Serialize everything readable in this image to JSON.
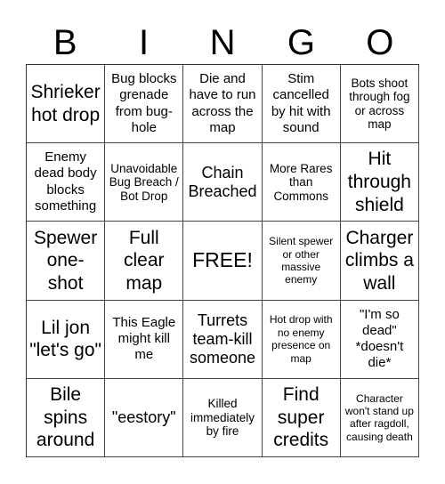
{
  "header": {
    "letters": [
      "B",
      "I",
      "N",
      "G",
      "O"
    ]
  },
  "grid": {
    "rows": [
      [
        {
          "text": "Shrieker hot drop"
        },
        {
          "text": "Bug blocks grenade from bug-hole"
        },
        {
          "text": "Die and have to run across the map"
        },
        {
          "text": "Stim cancelled by hit with sound"
        },
        {
          "text": "Bots shoot through fog or across map"
        }
      ],
      [
        {
          "text": "Enemy dead body blocks something"
        },
        {
          "text": "Unavoidable Bug Breach / Bot Drop"
        },
        {
          "text": "Chain Breached"
        },
        {
          "text": "More Rares than Commons"
        },
        {
          "text": "Hit through shield"
        }
      ],
      [
        {
          "text": "Spewer one-shot"
        },
        {
          "text": "Full clear map"
        },
        {
          "text": "FREE!"
        },
        {
          "text": "Silent spewer or other massive enemy"
        },
        {
          "text": "Charger climbs a wall"
        }
      ],
      [
        {
          "text": "Lil jon \"let's go\""
        },
        {
          "text": "This Eagle might kill me"
        },
        {
          "text": "Turrets team-kill someone"
        },
        {
          "text": "Hot drop with no enemy presence on map"
        },
        {
          "text": "\"I'm so dead\" *doesn't die*"
        }
      ],
      [
        {
          "text": "Bile spins around"
        },
        {
          "text": "\"eestory\""
        },
        {
          "text": "Killed immediately by fire"
        },
        {
          "text": "Find super credits"
        },
        {
          "text": "Character won't stand up after ragdoll, causing death"
        }
      ]
    ]
  }
}
